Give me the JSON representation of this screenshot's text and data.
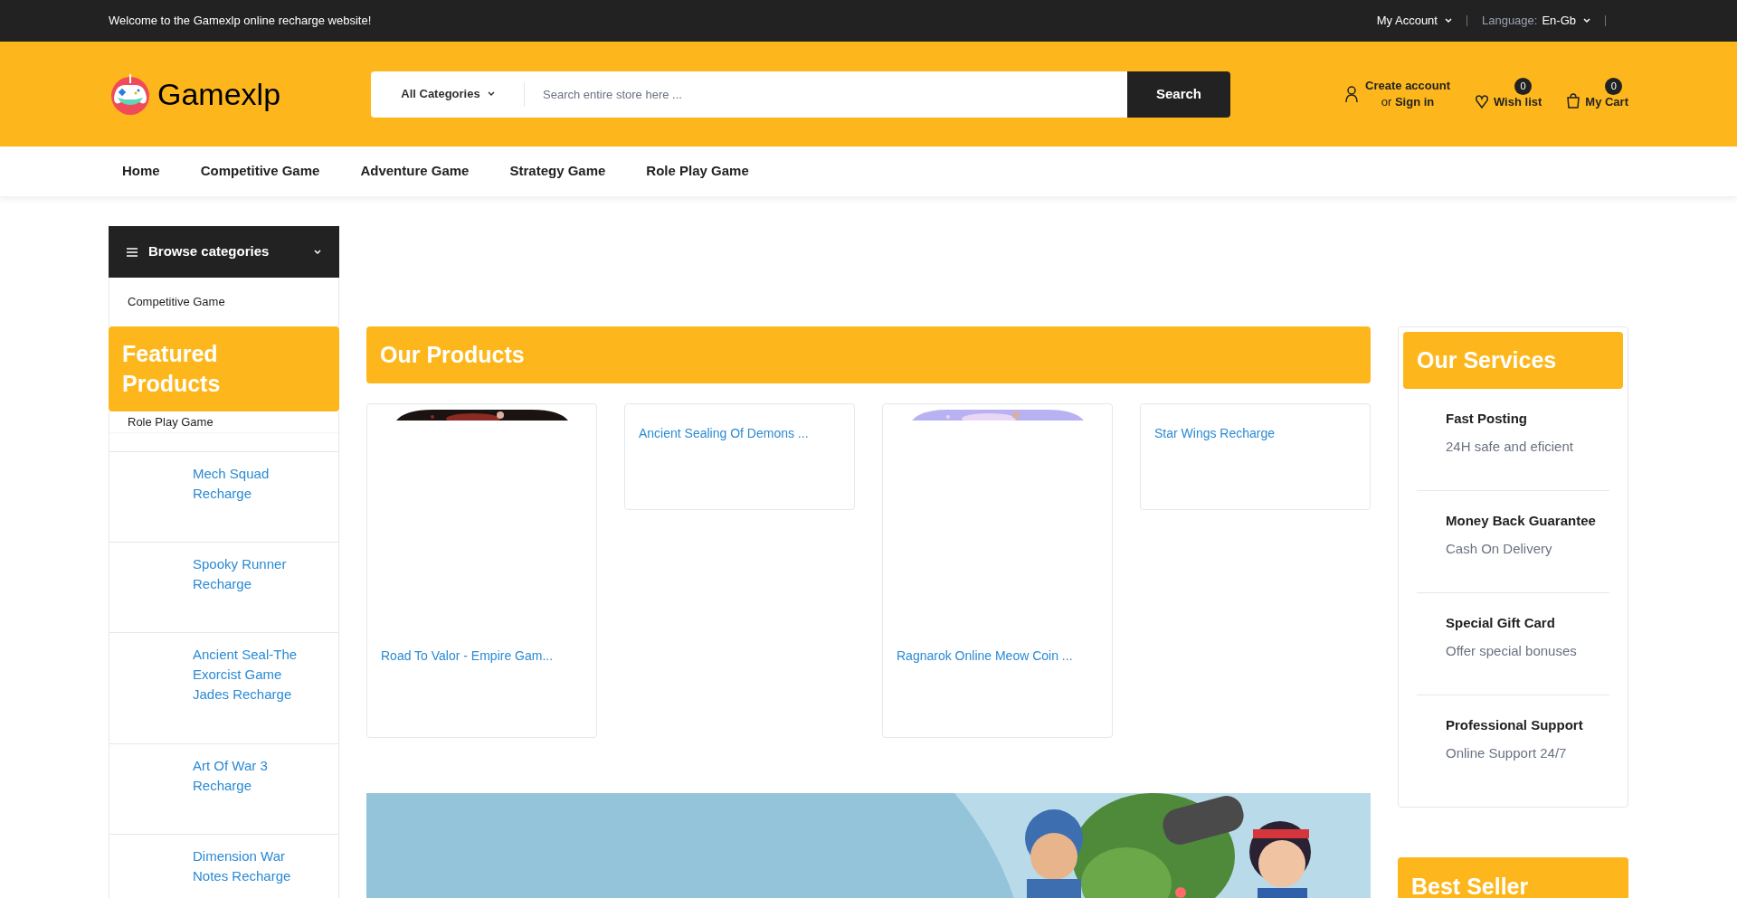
{
  "top_bar": {
    "welcome": "Welcome to the Gamexlp online recharge website!",
    "account": "My Account",
    "language_label": "Language:",
    "language_value": "En-Gb"
  },
  "header": {
    "logo": "Gamexlp",
    "category_select": "All Categories",
    "search_placeholder": "Search entire store here ...",
    "search_button": "Search",
    "create_account": "Create account",
    "or": "or",
    "sign_in": "Sign in",
    "wishlist": {
      "label": "Wish list",
      "count": "0"
    },
    "cart": {
      "label": "My Cart",
      "count": "0"
    }
  },
  "nav": [
    "Home",
    "Competitive Game",
    "Adventure Game",
    "Strategy Game",
    "Role Play Game"
  ],
  "sidebar": {
    "browse_title": "Browse categories",
    "categories": [
      "Competitive Game",
      "Role Play Game"
    ],
    "featured_title": "Featured Products",
    "featured": [
      "Mech Squad Recharge",
      "Spooky Runner Recharge",
      "Ancient Seal-The Exorcist Game Jades Recharge",
      "Art Of War 3 Recharge",
      "Dimension War Notes Recharge"
    ]
  },
  "products": {
    "title": "Our Products",
    "items": [
      {
        "name": "Road To Valor - Empire Gam..."
      },
      {
        "kind": "text",
        "name": "Ancient Sealing Of Demons ..."
      },
      {
        "name": "Ragnarok Online Meow Coin ..."
      },
      {
        "kind": "text",
        "name": "Star Wings Recharge"
      }
    ]
  },
  "services": {
    "title": "Our Services",
    "items": [
      {
        "title": "Fast Posting",
        "subtitle": "24H safe and eficient"
      },
      {
        "title": "Money Back Guarantee",
        "subtitle": "Cash On Delivery"
      },
      {
        "title": "Special Gift Card",
        "subtitle": "Offer special bonuses"
      },
      {
        "title": "Professional Support",
        "subtitle": "Online Support 24/7"
      }
    ]
  },
  "best_seller": {
    "title": "Best Seller"
  }
}
